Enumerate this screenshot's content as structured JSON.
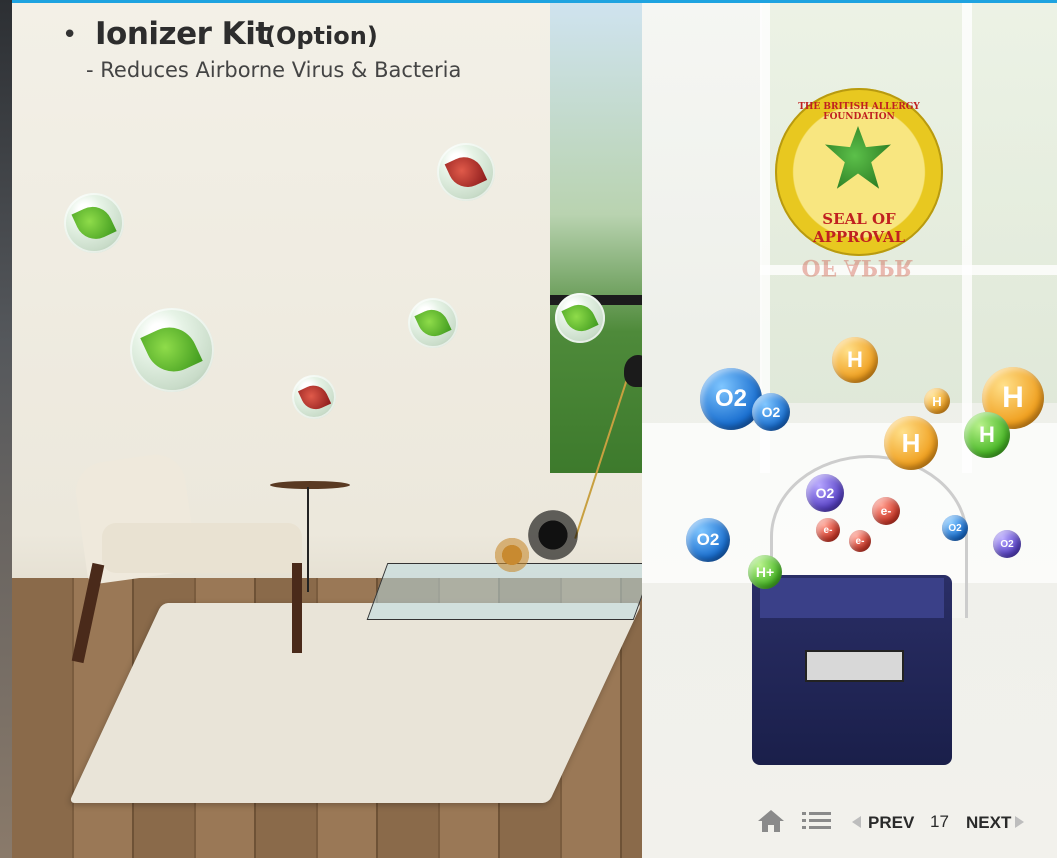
{
  "header": {
    "bullet": "•",
    "title": "Ionizer Kit",
    "title_suffix": "(Option)",
    "subtitle": "- Reduces Airborne Virus & Bacteria"
  },
  "seal": {
    "top_text": "THE BRITISH ALLERGY FOUNDATION",
    "bottom_text": "SEAL OF APPROVAL",
    "reflection_text": "OF APPR"
  },
  "molecules": {
    "o2_label": "O2",
    "o2_minus_label": "O2",
    "h_label": "H",
    "h_plus_label": "H+",
    "e_label": "e-"
  },
  "nav": {
    "prev_label": "PREV",
    "page_number": "17",
    "next_label": "NEXT"
  },
  "colors": {
    "accent_bar": "#1ea3e0",
    "seal_gold": "#e8c820",
    "o2_blue": "#1a6fd0",
    "h_orange": "#f0a020",
    "h_green": "#4ab828",
    "electron_red": "#d03a2a"
  }
}
